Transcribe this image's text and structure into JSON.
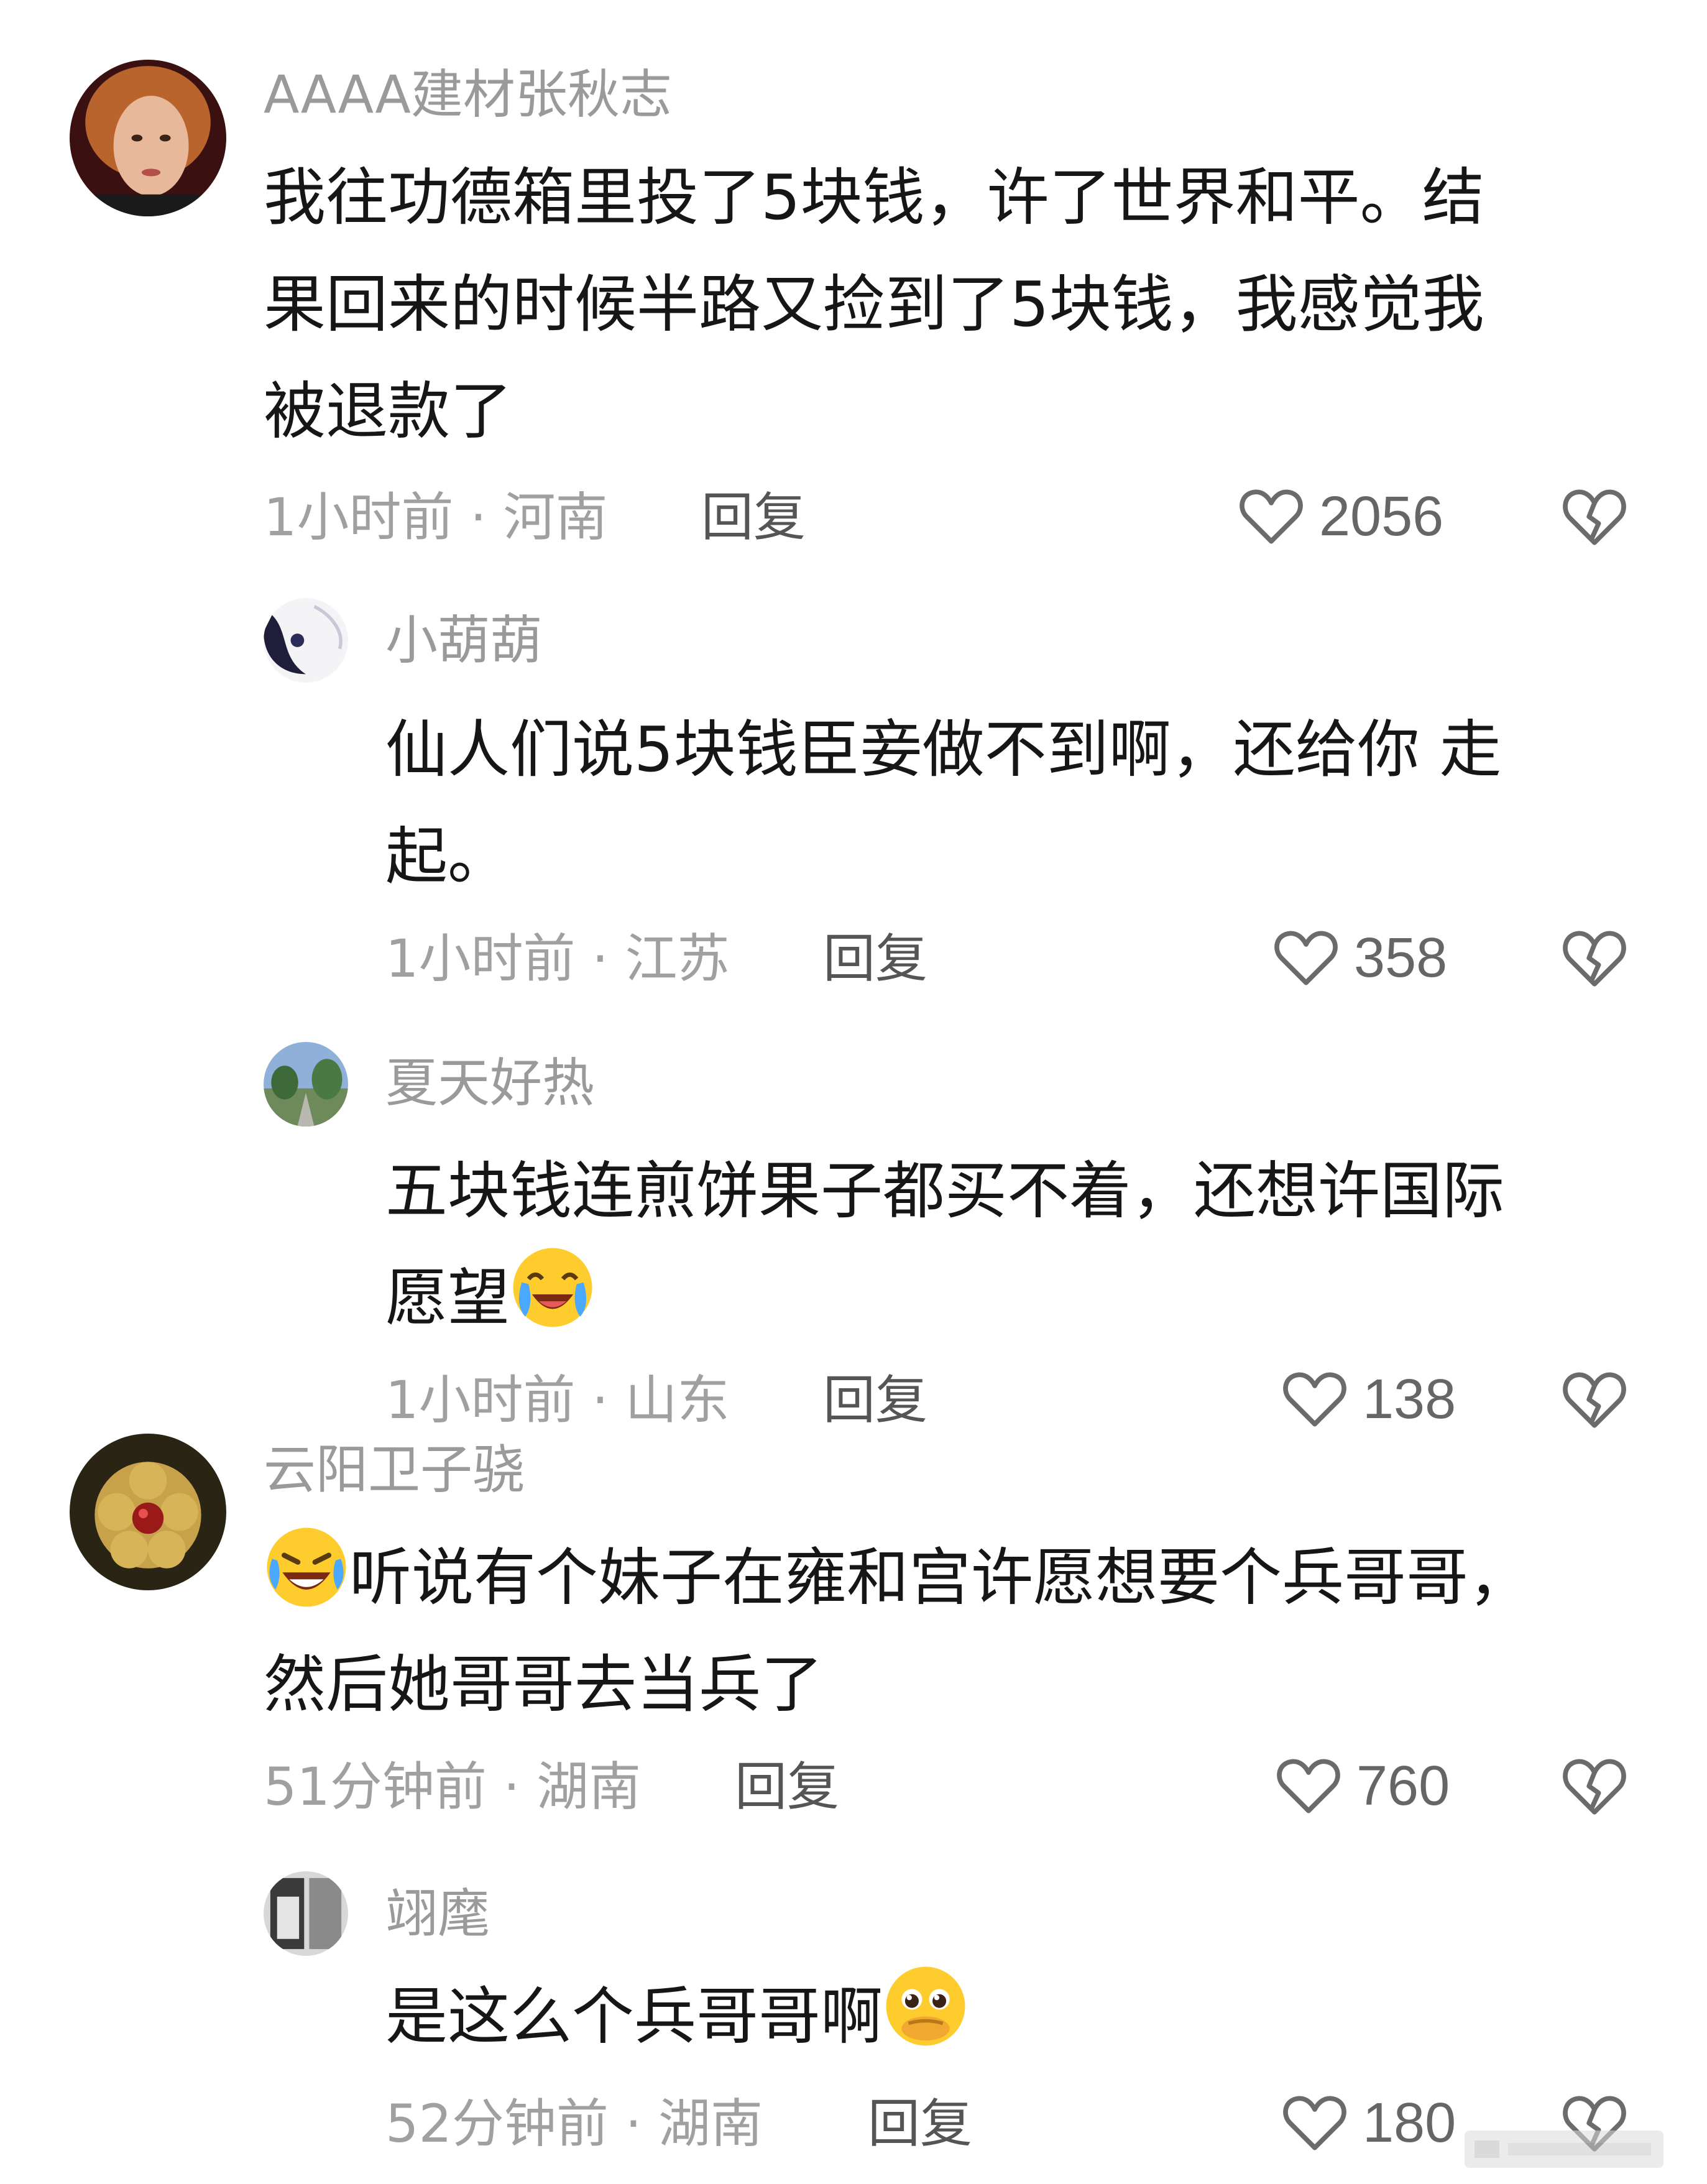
{
  "comments": [
    {
      "username": "AAAA建材张秋志",
      "lines": [
        "我往功德箱里投了5块钱，许了世界和平。结",
        "果回来的时候半路又捡到了5块钱，我感觉我",
        "被退款了"
      ],
      "time_location": "1小时前 · 河南",
      "reply_label": "回复",
      "likes": "2056"
    },
    {
      "username": "小葫葫",
      "lines": [
        "仙人们说5块钱臣妾做不到啊，还给你 走",
        "起。"
      ],
      "time_location": "1小时前 · 江苏",
      "reply_label": "回复",
      "likes": "358"
    },
    {
      "username": "夏天好热",
      "lines": [
        "五块钱连煎饼果子都买不着，还想许国际",
        "愿望"
      ],
      "time_location": "1小时前 · 山东",
      "reply_label": "回复",
      "likes": "138"
    },
    {
      "username": "云阳卫子骁",
      "lines": [
        "听说有个妹子在雍和宫许愿想要个兵哥哥，",
        "然后她哥哥去当兵了"
      ],
      "time_location": "51分钟前 · 湖南",
      "reply_label": "回复",
      "likes": "760"
    },
    {
      "username": "翊麾",
      "lines": [
        "是这么个兵哥哥啊"
      ],
      "time_location": "52分钟前 · 湖南",
      "reply_label": "回复",
      "likes": "180"
    }
  ],
  "icons": {
    "like": "heart-outline-icon",
    "dislike": "broken-heart-icon"
  },
  "colors": {
    "username": "#9a9a9a",
    "text": "#161616",
    "meta": "#a0a0a0",
    "reply": "#555555",
    "icon_stroke": "#6b6b6b"
  }
}
